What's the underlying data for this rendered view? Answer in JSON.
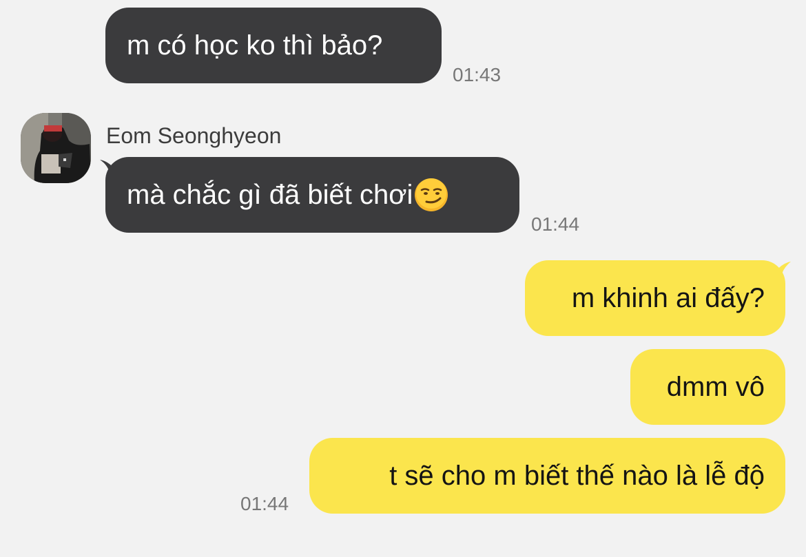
{
  "messages": [
    {
      "id": "m1",
      "direction": "received",
      "text": "m có học ko thì bảo?",
      "time": "01:43"
    },
    {
      "id": "m2",
      "direction": "received",
      "sender": "Eom Seonghyeon",
      "text": "mà chắc gì đã biết chơi",
      "emoji": "smirking-face",
      "time": "01:44"
    },
    {
      "id": "m3",
      "direction": "sent",
      "text": "m khinh ai đấy?"
    },
    {
      "id": "m4",
      "direction": "sent",
      "text": "dmm vô"
    },
    {
      "id": "m5",
      "direction": "sent",
      "text": "t sẽ cho m biết thế nào là lễ độ",
      "time": "01:44"
    }
  ],
  "colors": {
    "background": "#f2f2f2",
    "received_bubble": "#3b3b3d",
    "sent_bubble": "#fbe54d",
    "timestamp": "#777777"
  }
}
